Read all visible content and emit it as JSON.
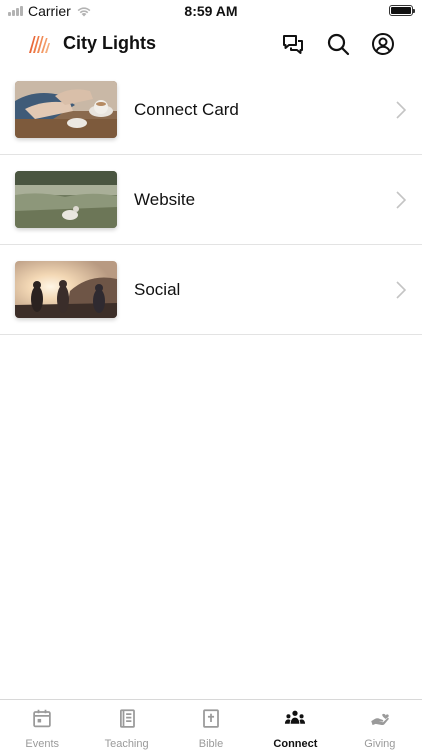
{
  "status_bar": {
    "carrier": "Carrier",
    "time": "8:59 AM"
  },
  "header": {
    "title": "City Lights",
    "icons": [
      "chat-icon",
      "search-icon",
      "profile-icon"
    ]
  },
  "connect_list": {
    "items": [
      {
        "label": "Connect Card",
        "thumbnail": "coffee-table-photo"
      },
      {
        "label": "Website",
        "thumbnail": "meadow-photo"
      },
      {
        "label": "Social",
        "thumbnail": "sunset-friends-photo"
      }
    ]
  },
  "tab_bar": {
    "tabs": [
      {
        "label": "Events",
        "icon": "calendar-icon",
        "active": false
      },
      {
        "label": "Teaching",
        "icon": "book-icon",
        "active": false
      },
      {
        "label": "Bible",
        "icon": "bible-icon",
        "active": false
      },
      {
        "label": "Connect",
        "icon": "people-icon",
        "active": true
      },
      {
        "label": "Giving",
        "icon": "giving-hand-icon",
        "active": false
      }
    ]
  },
  "colors": {
    "brand_accent": "#e8683a",
    "active_tab": "#111111",
    "inactive_tab": "#9a9a9a"
  }
}
